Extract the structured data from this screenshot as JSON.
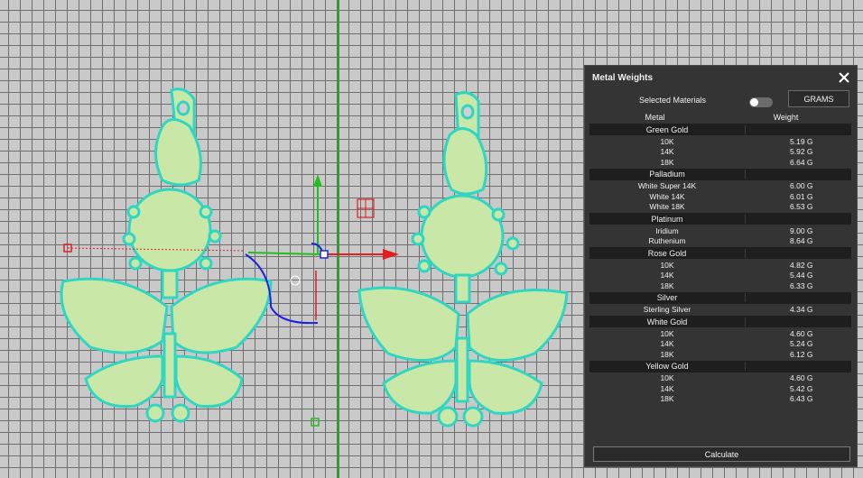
{
  "panel": {
    "title": "Metal Weights",
    "selected_materials_label": "Selected Materials",
    "units_button": "GRAMS",
    "toggle_on": false,
    "columns": [
      "Metal",
      "Weight"
    ],
    "groups": [
      {
        "name": "Green Gold",
        "rows": [
          {
            "metal": "10K",
            "weight": "5.19 G"
          },
          {
            "metal": "14K",
            "weight": "5.92 G"
          },
          {
            "metal": "18K",
            "weight": "6.64 G"
          }
        ]
      },
      {
        "name": "Palladium",
        "rows": [
          {
            "metal": "White Super 14K",
            "weight": "6.00 G"
          },
          {
            "metal": "White 14K",
            "weight": "6.01 G"
          },
          {
            "metal": "White 18K",
            "weight": "6.53 G"
          }
        ]
      },
      {
        "name": "Platinum",
        "rows": [
          {
            "metal": "Iridium",
            "weight": "9.00 G"
          },
          {
            "metal": "Ruthenium",
            "weight": "8.64 G"
          }
        ]
      },
      {
        "name": "Rose Gold",
        "rows": [
          {
            "metal": "10K",
            "weight": "4.82 G"
          },
          {
            "metal": "14K",
            "weight": "5.44 G"
          },
          {
            "metal": "18K",
            "weight": "6.33 G"
          }
        ]
      },
      {
        "name": "Silver",
        "rows": [
          {
            "metal": "Sterling Silver",
            "weight": "4.34 G"
          }
        ]
      },
      {
        "name": "White Gold",
        "rows": [
          {
            "metal": "10K",
            "weight": "4.60 G"
          },
          {
            "metal": "14K",
            "weight": "5.24 G"
          },
          {
            "metal": "18K",
            "weight": "6.12 G"
          }
        ]
      },
      {
        "name": "Yellow Gold",
        "rows": [
          {
            "metal": "10K",
            "weight": "4.60 G"
          },
          {
            "metal": "14K",
            "weight": "5.42 G"
          },
          {
            "metal": "18K",
            "weight": "6.43 G"
          }
        ]
      }
    ],
    "calculate_label": "Calculate"
  },
  "viewport": {
    "model_fill": "#c9e8a8",
    "model_outline": "#2fd6c2",
    "axis_x_color": "#e02020",
    "axis_y_color": "#20c020",
    "axis_z_color": "#2020e0"
  }
}
